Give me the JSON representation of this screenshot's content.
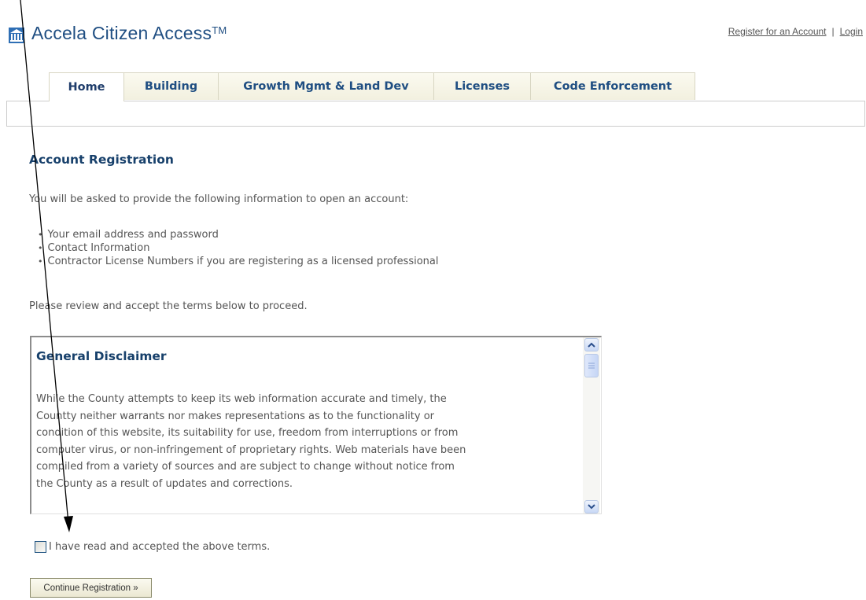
{
  "header": {
    "logo_icon": "accela-building-icon",
    "app_title": "Accela Citizen Access",
    "trademark": "TM",
    "links": {
      "register": "Register for an Account",
      "separator": "|",
      "login": "Login"
    }
  },
  "tabs": [
    {
      "label": "Home",
      "active": true
    },
    {
      "label": "Building",
      "active": false
    },
    {
      "label": "Growth Mgmt & Land Dev",
      "active": false
    },
    {
      "label": "Licenses",
      "active": false
    },
    {
      "label": "Code Enforcement",
      "active": false
    }
  ],
  "main": {
    "heading": "Account Registration",
    "intro": "You will be asked to provide the following information to open an account:",
    "bullets": [
      "Your email address and password",
      "Contact Information",
      "Contractor License Numbers if you are registering as a licensed professional"
    ],
    "review_text": "Please review and accept the terms below to proceed."
  },
  "disclaimer": {
    "title": "General Disclaimer",
    "lines": [
      "While the County attempts to keep its web information accurate and timely, the",
      "Countty neither warrants nor makes representations as to the functionality or",
      "condition of this website, its suitability for use, freedom from interruptions or from",
      "computer virus, or non-infringement of proprietary rights. Web materials have been",
      "compiled from a variety of sources and are subject to change without notice from",
      "the County as a result of updates and corrections."
    ]
  },
  "accept": {
    "checked": false,
    "label": "I have read and accepted the above terms."
  },
  "continue_button": "Continue Registration »",
  "colors": {
    "brand_blue": "#1f4e82",
    "heading_blue": "#17406b",
    "tab_bg": "#f2f0df",
    "body_text": "#555555"
  }
}
